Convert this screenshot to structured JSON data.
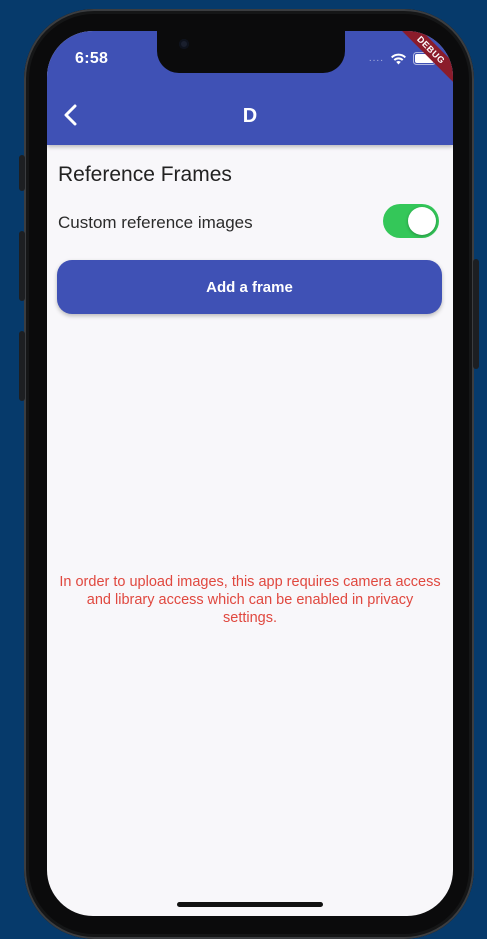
{
  "status_bar": {
    "time": "6:58",
    "signal": "....",
    "wifi_icon": "wifi-icon",
    "battery_icon": "battery-icon",
    "debug_banner": "DEBUG"
  },
  "app_bar": {
    "back_icon": "chevron-left-icon",
    "title": "D",
    "color": "#3f51b5"
  },
  "content": {
    "section_title": "Reference Frames",
    "toggle_label": "Custom reference images",
    "toggle_on": true,
    "toggle_color": "#34c759",
    "add_button_label": "Add a frame",
    "notice": "In order to upload images, this app requires camera access and library access which can be enabled in privacy settings.",
    "notice_color": "#e0483f"
  }
}
